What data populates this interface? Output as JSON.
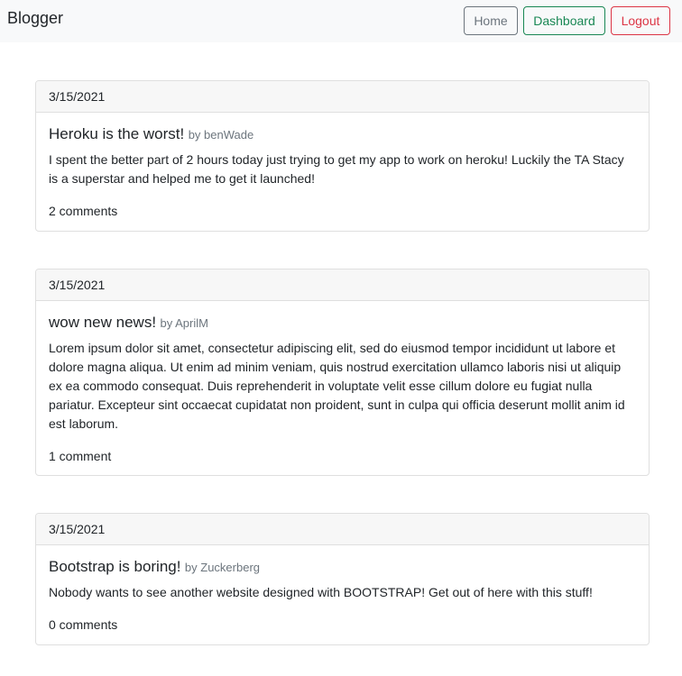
{
  "navbar": {
    "brand": "Blogger",
    "buttons": {
      "home": "Home",
      "dashboard": "Dashboard",
      "logout": "Logout"
    }
  },
  "posts": [
    {
      "date": "3/15/2021",
      "title": "Heroku is the worst!",
      "by": "by benWade",
      "content": "I spent the better part of 2 hours today just trying to get my app to work on heroku! Luckily the TA Stacy is a superstar and helped me to get it launched!",
      "comments": "2 comments"
    },
    {
      "date": "3/15/2021",
      "title": "wow new news!",
      "by": "by AprilM",
      "content": "Lorem ipsum dolor sit amet, consectetur adipiscing elit, sed do eiusmod tempor incididunt ut labore et dolore magna aliqua. Ut enim ad minim veniam, quis nostrud exercitation ullamco laboris nisi ut aliquip ex ea commodo consequat. Duis reprehenderit in voluptate velit esse cillum dolore eu fugiat nulla pariatur. Excepteur sint occaecat cupidatat non proident, sunt in culpa qui officia deserunt mollit anim id est laborum.",
      "comments": "1 comment"
    },
    {
      "date": "3/15/2021",
      "title": "Bootstrap is boring!",
      "by": "by Zuckerberg",
      "content": "Nobody wants to see another website designed with BOOTSTRAP! Get out of here with this stuff!",
      "comments": "0 comments"
    }
  ]
}
